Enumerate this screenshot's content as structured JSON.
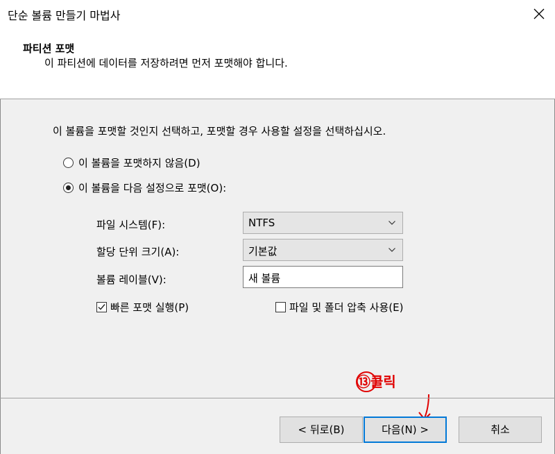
{
  "window": {
    "title": "단순 볼륨 만들기 마법사"
  },
  "header": {
    "title": "파티션 포맷",
    "subtitle": "이 파티션에 데이터를 저장하려면 먼저 포맷해야 합니다."
  },
  "content": {
    "instruction": "이 볼륨을 포맷할 것인지 선택하고, 포맷할 경우 사용할 설정을 선택하십시오.",
    "radio_no_format": {
      "label": "이 볼륨을 포맷하지 않음(D)",
      "checked": false
    },
    "radio_format": {
      "label": "이 볼륨을 다음 설정으로 포맷(O):",
      "checked": true
    },
    "file_system": {
      "label": "파일 시스템(F):",
      "value": "NTFS"
    },
    "allocation_unit": {
      "label": "할당 단위 크기(A):",
      "value": "기본값"
    },
    "volume_label": {
      "label": "볼륨 레이블(V):",
      "value": "새 볼륨"
    },
    "quick_format": {
      "label": "빠른 포맷 실행(P)",
      "checked": true
    },
    "compression": {
      "label": "파일 및 폴더 압축 사용(E)",
      "checked": false
    }
  },
  "buttons": {
    "back": "< 뒤로(B)",
    "next": "다음(N) >",
    "cancel": "취소"
  },
  "annotation": {
    "text": "⑬클릭",
    "color": "#e00000"
  },
  "icons": {
    "close": "close-icon",
    "dropdown": "chevron-down-icon",
    "check": "checkmark-icon"
  }
}
